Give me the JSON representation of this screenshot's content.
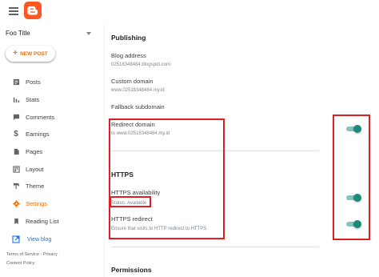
{
  "header": {
    "menu_icon": "hamburger-icon",
    "logo_icon": "blogger-logo",
    "logo_color": "#ff5722"
  },
  "sidebar": {
    "blog_title": "Foo Title",
    "new_post_label": "NEW POST",
    "items": [
      {
        "label": "Posts",
        "icon": "posts-icon"
      },
      {
        "label": "Stats",
        "icon": "stats-icon"
      },
      {
        "label": "Comments",
        "icon": "comments-icon"
      },
      {
        "label": "Earnings",
        "icon": "dollar-icon"
      },
      {
        "label": "Pages",
        "icon": "pages-icon"
      },
      {
        "label": "Layout",
        "icon": "layout-icon"
      },
      {
        "label": "Theme",
        "icon": "theme-icon"
      },
      {
        "label": "Settings",
        "icon": "gear-icon",
        "active": true
      },
      {
        "label": "Reading List",
        "icon": "bookmark-icon"
      }
    ],
    "view_blog_label": "View blog",
    "footer": {
      "terms": "Terms of Service",
      "sep1": " · ",
      "privacy": "Privacy",
      "sep2": " · ",
      "content_policy": "Content Policy"
    }
  },
  "main": {
    "publishing": {
      "heading": "Publishing",
      "blog_address_label": "Blog address",
      "blog_address_value": "02518348484.blogspot.com",
      "custom_domain_label": "Custom domain",
      "custom_domain_value": "www.02518348484.my.id",
      "fallback_label": "Fallback subdomain",
      "redirect_label": "Redirect domain",
      "redirect_value": "to www.02518348484.my.id",
      "redirect_enabled": true
    },
    "https": {
      "heading": "HTTPS",
      "availability_label": "HTTPS availability",
      "availability_status": "Status: Available",
      "availability_enabled": true,
      "redirect_label": "HTTPS redirect",
      "redirect_desc": "Ensure that visits to HTTP redirect to HTTPS",
      "redirect_enabled": true
    },
    "permissions": {
      "heading": "Permissions"
    }
  },
  "colors": {
    "accent": "#e8710a",
    "toggle_on": "#1b8a7a",
    "highlight": "#e02020",
    "link": "#1a73e8"
  }
}
